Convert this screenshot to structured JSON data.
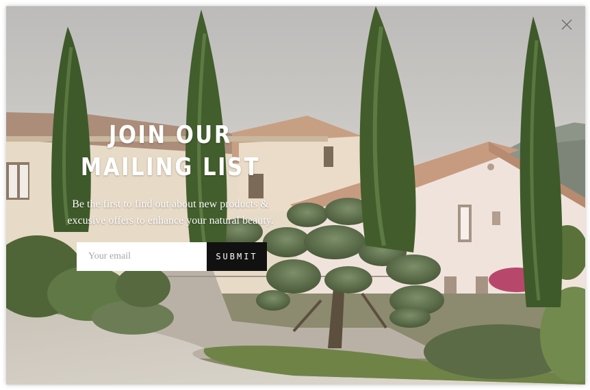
{
  "popup": {
    "heading_line1": "JOIN OUR",
    "heading_line2": "MAILING LIST",
    "subtext_line1": "Be the first to find out about new products &",
    "subtext_line2": "excusive offers to enhance your natural beauty.",
    "email_placeholder": "Your email",
    "submit_label": "SUBMIT",
    "close_icon": "close-icon"
  },
  "colors": {
    "button_bg": "#111111",
    "text": "#ffffff",
    "sky": "#c9c7c4",
    "foliage": "#4e6a35"
  }
}
